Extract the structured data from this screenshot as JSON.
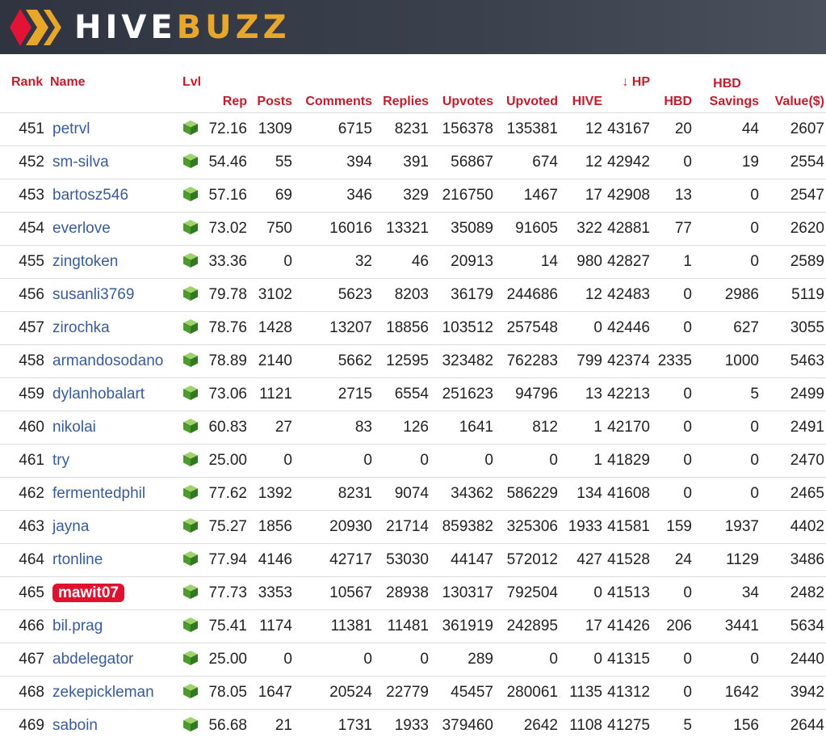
{
  "brand": {
    "part1": "HIVE",
    "part2": "BUZZ",
    "accent": "#e8a72a",
    "hive_red": "#e31337"
  },
  "icons": {
    "level": "green-cube-icon",
    "sort": "arrow-down-icon"
  },
  "colors": {
    "header_text": "#bf1e2e",
    "name_link": "#3a5c96",
    "highlight": "#e0102f"
  },
  "table": {
    "headers": {
      "rank": "Rank",
      "name": "Name",
      "lvl": "Lvl",
      "rep": "Rep",
      "posts": "Posts",
      "comments": "Comments",
      "replies": "Replies",
      "upvotes": "Upvotes",
      "upvoted": "Upvoted",
      "hive": "HIVE",
      "sort_arrow": "↓",
      "hp": "HP",
      "hbd": "HBD",
      "hbd_savings_line1": "HBD",
      "hbd_savings_line2": "Savings",
      "value": "Value($)"
    },
    "rows": [
      {
        "rank": "451",
        "name": "petrvl",
        "rep": "72.16",
        "posts": "1309",
        "comments": "6715",
        "replies": "8231",
        "upvotes": "156378",
        "upvoted": "135381",
        "hive": "12",
        "hp": "43167",
        "hbd": "20",
        "savings": "44",
        "value": "2607",
        "highlight": false
      },
      {
        "rank": "452",
        "name": "sm-silva",
        "rep": "54.46",
        "posts": "55",
        "comments": "394",
        "replies": "391",
        "upvotes": "56867",
        "upvoted": "674",
        "hive": "12",
        "hp": "42942",
        "hbd": "0",
        "savings": "19",
        "value": "2554",
        "highlight": false
      },
      {
        "rank": "453",
        "name": "bartosz546",
        "rep": "57.16",
        "posts": "69",
        "comments": "346",
        "replies": "329",
        "upvotes": "216750",
        "upvoted": "1467",
        "hive": "17",
        "hp": "42908",
        "hbd": "13",
        "savings": "0",
        "value": "2547",
        "highlight": false
      },
      {
        "rank": "454",
        "name": "everlove",
        "rep": "73.02",
        "posts": "750",
        "comments": "16016",
        "replies": "13321",
        "upvotes": "35089",
        "upvoted": "91605",
        "hive": "322",
        "hp": "42881",
        "hbd": "77",
        "savings": "0",
        "value": "2620",
        "highlight": false
      },
      {
        "rank": "455",
        "name": "zingtoken",
        "rep": "33.36",
        "posts": "0",
        "comments": "32",
        "replies": "46",
        "upvotes": "20913",
        "upvoted": "14",
        "hive": "980",
        "hp": "42827",
        "hbd": "1",
        "savings": "0",
        "value": "2589",
        "highlight": false
      },
      {
        "rank": "456",
        "name": "susanli3769",
        "rep": "79.78",
        "posts": "3102",
        "comments": "5623",
        "replies": "8203",
        "upvotes": "36179",
        "upvoted": "244686",
        "hive": "12",
        "hp": "42483",
        "hbd": "0",
        "savings": "2986",
        "value": "5119",
        "highlight": false
      },
      {
        "rank": "457",
        "name": "zirochka",
        "rep": "78.76",
        "posts": "1428",
        "comments": "13207",
        "replies": "18856",
        "upvotes": "103512",
        "upvoted": "257548",
        "hive": "0",
        "hp": "42446",
        "hbd": "0",
        "savings": "627",
        "value": "3055",
        "highlight": false
      },
      {
        "rank": "458",
        "name": "armandosodano",
        "rep": "78.89",
        "posts": "2140",
        "comments": "5662",
        "replies": "12595",
        "upvotes": "323482",
        "upvoted": "762283",
        "hive": "799",
        "hp": "42374",
        "hbd": "2335",
        "savings": "1000",
        "value": "5463",
        "highlight": false
      },
      {
        "rank": "459",
        "name": "dylanhobalart",
        "rep": "73.06",
        "posts": "1121",
        "comments": "2715",
        "replies": "6554",
        "upvotes": "251623",
        "upvoted": "94796",
        "hive": "13",
        "hp": "42213",
        "hbd": "0",
        "savings": "5",
        "value": "2499",
        "highlight": false
      },
      {
        "rank": "460",
        "name": "nikolai",
        "rep": "60.83",
        "posts": "27",
        "comments": "83",
        "replies": "126",
        "upvotes": "1641",
        "upvoted": "812",
        "hive": "1",
        "hp": "42170",
        "hbd": "0",
        "savings": "0",
        "value": "2491",
        "highlight": false
      },
      {
        "rank": "461",
        "name": "try",
        "rep": "25.00",
        "posts": "0",
        "comments": "0",
        "replies": "0",
        "upvotes": "0",
        "upvoted": "0",
        "hive": "1",
        "hp": "41829",
        "hbd": "0",
        "savings": "0",
        "value": "2470",
        "highlight": false
      },
      {
        "rank": "462",
        "name": "fermentedphil",
        "rep": "77.62",
        "posts": "1392",
        "comments": "8231",
        "replies": "9074",
        "upvotes": "34362",
        "upvoted": "586229",
        "hive": "134",
        "hp": "41608",
        "hbd": "0",
        "savings": "0",
        "value": "2465",
        "highlight": false
      },
      {
        "rank": "463",
        "name": "jayna",
        "rep": "75.27",
        "posts": "1856",
        "comments": "20930",
        "replies": "21714",
        "upvotes": "859382",
        "upvoted": "325306",
        "hive": "1933",
        "hp": "41581",
        "hbd": "159",
        "savings": "1937",
        "value": "4402",
        "highlight": false
      },
      {
        "rank": "464",
        "name": "rtonline",
        "rep": "77.94",
        "posts": "4146",
        "comments": "42717",
        "replies": "53030",
        "upvotes": "44147",
        "upvoted": "572012",
        "hive": "427",
        "hp": "41528",
        "hbd": "24",
        "savings": "1129",
        "value": "3486",
        "highlight": false
      },
      {
        "rank": "465",
        "name": "mawit07",
        "rep": "77.73",
        "posts": "3353",
        "comments": "10567",
        "replies": "28938",
        "upvotes": "130317",
        "upvoted": "792504",
        "hive": "0",
        "hp": "41513",
        "hbd": "0",
        "savings": "34",
        "value": "2482",
        "highlight": true
      },
      {
        "rank": "466",
        "name": "bil.prag",
        "rep": "75.41",
        "posts": "1174",
        "comments": "11381",
        "replies": "11481",
        "upvotes": "361919",
        "upvoted": "242895",
        "hive": "17",
        "hp": "41426",
        "hbd": "206",
        "savings": "3441",
        "value": "5634",
        "highlight": false
      },
      {
        "rank": "467",
        "name": "abdelegator",
        "rep": "25.00",
        "posts": "0",
        "comments": "0",
        "replies": "0",
        "upvotes": "289",
        "upvoted": "0",
        "hive": "0",
        "hp": "41315",
        "hbd": "0",
        "savings": "0",
        "value": "2440",
        "highlight": false
      },
      {
        "rank": "468",
        "name": "zekepickleman",
        "rep": "78.05",
        "posts": "1647",
        "comments": "20524",
        "replies": "22779",
        "upvotes": "45457",
        "upvoted": "280061",
        "hive": "1135",
        "hp": "41312",
        "hbd": "0",
        "savings": "1642",
        "value": "3942",
        "highlight": false
      },
      {
        "rank": "469",
        "name": "saboin",
        "rep": "56.68",
        "posts": "21",
        "comments": "1731",
        "replies": "1933",
        "upvotes": "379460",
        "upvoted": "2642",
        "hive": "1108",
        "hp": "41275",
        "hbd": "5",
        "savings": "156",
        "value": "2644",
        "highlight": false
      }
    ]
  }
}
